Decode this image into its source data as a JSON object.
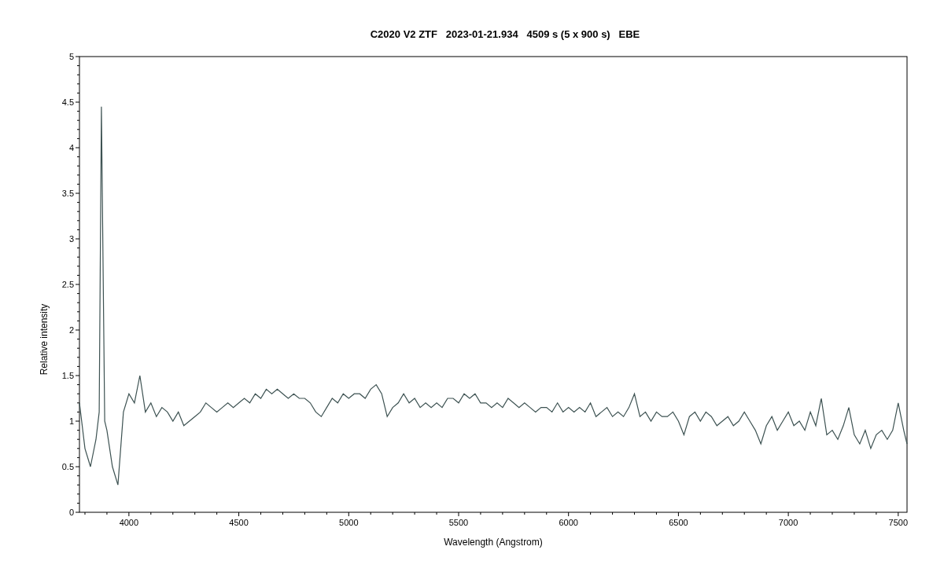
{
  "chart_data": {
    "type": "line",
    "title": "C2020 V2 ZTF   2023-01-21.934   4509 s (5 x 900 s)   EBE",
    "xlabel": "Wavelength (Angstrom)",
    "ylabel": "Relative intensity",
    "xlim": [
      3775,
      7540
    ],
    "ylim": [
      0,
      5
    ],
    "xticks": [
      4000,
      4500,
      5000,
      5500,
      6000,
      6500,
      7000,
      7500
    ],
    "yticks": [
      0,
      0.5,
      1,
      1.5,
      2,
      2.5,
      3,
      3.5,
      4,
      4.5,
      5
    ],
    "x": [
      3775,
      3800,
      3825,
      3850,
      3865,
      3875,
      3890,
      3900,
      3925,
      3950,
      3975,
      4000,
      4025,
      4050,
      4075,
      4100,
      4125,
      4150,
      4175,
      4200,
      4225,
      4250,
      4275,
      4300,
      4325,
      4350,
      4375,
      4400,
      4425,
      4450,
      4475,
      4500,
      4525,
      4550,
      4575,
      4600,
      4625,
      4650,
      4675,
      4700,
      4725,
      4750,
      4775,
      4800,
      4825,
      4850,
      4875,
      4900,
      4925,
      4950,
      4975,
      5000,
      5025,
      5050,
      5075,
      5100,
      5125,
      5150,
      5175,
      5200,
      5225,
      5250,
      5275,
      5300,
      5325,
      5350,
      5375,
      5400,
      5425,
      5450,
      5475,
      5500,
      5525,
      5550,
      5575,
      5600,
      5625,
      5650,
      5675,
      5700,
      5725,
      5750,
      5775,
      5800,
      5825,
      5850,
      5875,
      5900,
      5925,
      5950,
      5975,
      6000,
      6025,
      6050,
      6075,
      6100,
      6125,
      6150,
      6175,
      6200,
      6225,
      6250,
      6275,
      6300,
      6325,
      6350,
      6375,
      6400,
      6425,
      6450,
      6475,
      6500,
      6525,
      6550,
      6575,
      6600,
      6625,
      6650,
      6675,
      6700,
      6725,
      6750,
      6775,
      6800,
      6825,
      6850,
      6875,
      6900,
      6925,
      6950,
      6975,
      7000,
      7025,
      7050,
      7075,
      7100,
      7125,
      7150,
      7175,
      7200,
      7225,
      7250,
      7275,
      7300,
      7325,
      7350,
      7375,
      7400,
      7425,
      7450,
      7475,
      7500,
      7525,
      7540
    ],
    "series": [
      {
        "color": "#3d5252",
        "values": [
          1.2,
          0.7,
          0.5,
          0.8,
          1.1,
          4.45,
          1.0,
          0.9,
          0.5,
          0.3,
          1.1,
          1.3,
          1.2,
          1.5,
          1.1,
          1.2,
          1.05,
          1.15,
          1.1,
          1.0,
          1.1,
          0.95,
          1.0,
          1.05,
          1.1,
          1.2,
          1.15,
          1.1,
          1.15,
          1.2,
          1.15,
          1.2,
          1.25,
          1.2,
          1.3,
          1.25,
          1.35,
          1.3,
          1.35,
          1.3,
          1.25,
          1.3,
          1.25,
          1.25,
          1.2,
          1.1,
          1.05,
          1.15,
          1.25,
          1.2,
          1.3,
          1.25,
          1.3,
          1.3,
          1.25,
          1.35,
          1.4,
          1.3,
          1.05,
          1.15,
          1.2,
          1.3,
          1.2,
          1.25,
          1.15,
          1.2,
          1.15,
          1.2,
          1.15,
          1.25,
          1.25,
          1.2,
          1.3,
          1.25,
          1.3,
          1.2,
          1.2,
          1.15,
          1.2,
          1.15,
          1.25,
          1.2,
          1.15,
          1.2,
          1.15,
          1.1,
          1.15,
          1.15,
          1.1,
          1.2,
          1.1,
          1.15,
          1.1,
          1.15,
          1.1,
          1.2,
          1.05,
          1.1,
          1.15,
          1.05,
          1.1,
          1.05,
          1.15,
          1.3,
          1.05,
          1.1,
          1.0,
          1.1,
          1.05,
          1.05,
          1.1,
          1.0,
          0.85,
          1.05,
          1.1,
          1.0,
          1.1,
          1.05,
          0.95,
          1.0,
          1.05,
          0.95,
          1.0,
          1.1,
          1.0,
          0.9,
          0.75,
          0.95,
          1.05,
          0.9,
          1.0,
          1.1,
          0.95,
          1.0,
          0.9,
          1.1,
          0.95,
          1.25,
          0.85,
          0.9,
          0.8,
          0.95,
          1.15,
          0.85,
          0.75,
          0.9,
          0.7,
          0.85,
          0.9,
          0.8,
          0.9,
          1.2,
          0.9,
          0.75
        ]
      }
    ]
  }
}
